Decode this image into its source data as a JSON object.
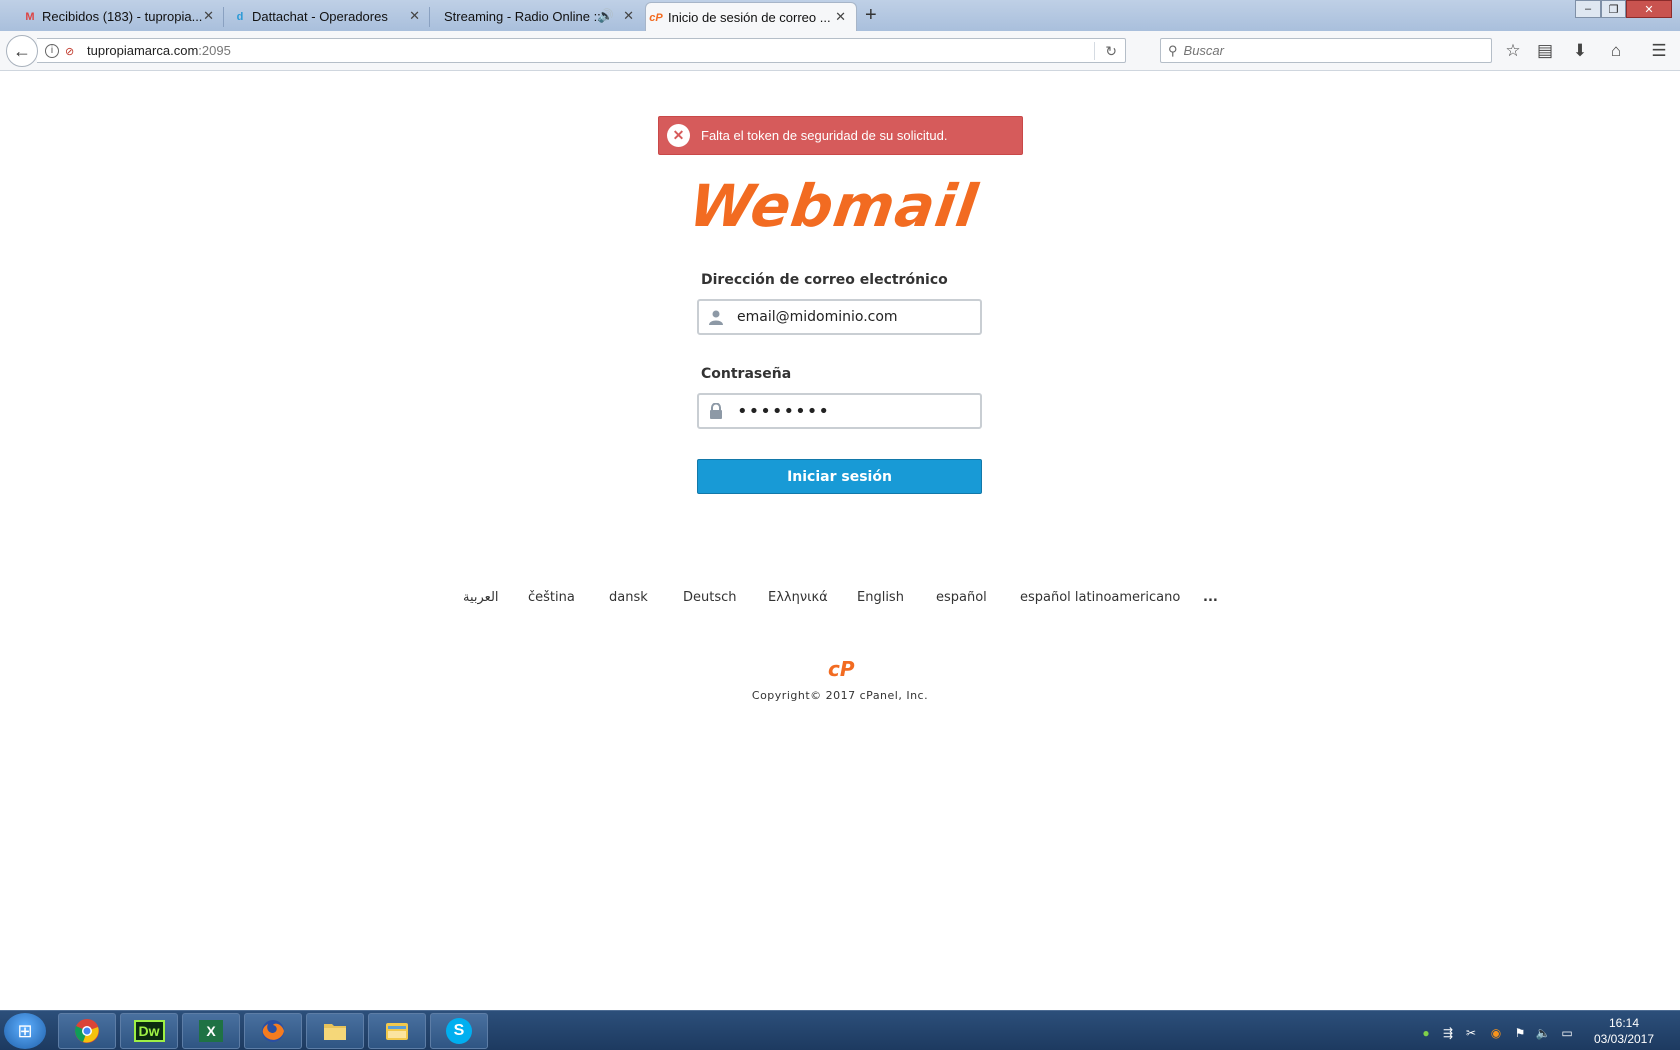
{
  "browser": {
    "tabs": [
      {
        "title": "Recibidos (183) - tupropia...",
        "favicon": "gmail-icon",
        "active": false
      },
      {
        "title": "Dattachat - Operadores",
        "favicon": "dattachat-icon",
        "active": false
      },
      {
        "title": "Streaming - Radio Online ::::...",
        "favicon": "audio-icon",
        "active": false
      },
      {
        "title": "Inicio de sesión de correo ...",
        "favicon": "cpanel-icon",
        "active": true
      }
    ],
    "url_host": "tupropiamarca.com",
    "url_port": ":2095",
    "search_placeholder": "Buscar"
  },
  "page": {
    "alert_message": "Falta el token de seguridad de su solicitud.",
    "logo_text": "Webmail",
    "email_label": "Dirección de correo electrónico",
    "email_value": "email@midominio.com",
    "password_label": "Contraseña",
    "password_value": "password",
    "login_button": "Iniciar sesión",
    "languages": [
      "العربية",
      "čeština",
      "dansk",
      "Deutsch",
      "Ελληνικά",
      "English",
      "español",
      "español latinoamericano",
      "..."
    ],
    "cpanel_logo": "cP",
    "copyright": "Copyright© 2017 cPanel, Inc."
  },
  "taskbar": {
    "apps": [
      "chrome-icon",
      "dreamweaver-icon",
      "excel-icon",
      "firefox-icon",
      "folder-icon",
      "explorer-icon",
      "skype-icon"
    ],
    "dw_label": "Dw",
    "excel_label": "X",
    "skype_label": "S",
    "time": "16:14",
    "date": "03/03/2017"
  },
  "colors": {
    "alert": "#d65b5b",
    "brand_orange": "#f26b21",
    "primary_button": "#189ad6"
  }
}
